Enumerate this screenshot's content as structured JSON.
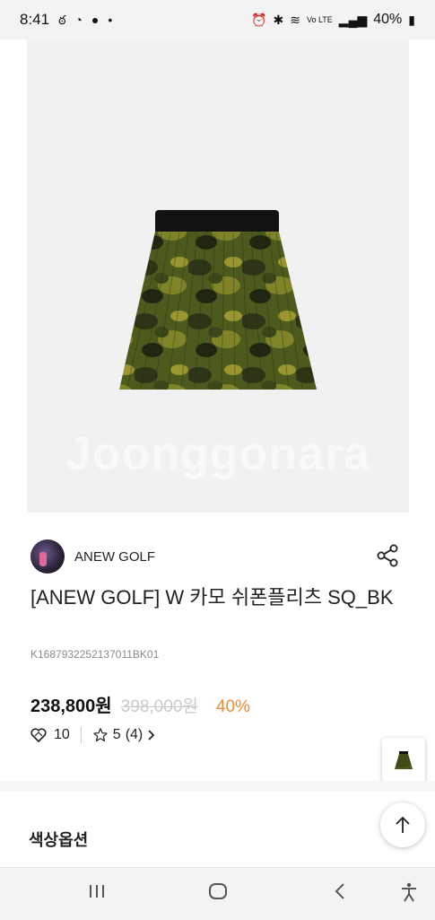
{
  "status": {
    "time": "8:41",
    "battery": "40%",
    "network": "Vo LTE"
  },
  "product": {
    "watermark": "Joonggonara",
    "brand": "ANEW GOLF",
    "title": "[ANEW GOLF] W 카모 쉬폰플리츠 SQ_BK",
    "code": "K1687932252137011BK01",
    "price": "238,800원",
    "original_price": "398,000원",
    "discount": "40%",
    "likes": "10",
    "rating": "5",
    "review_count": "(4)"
  },
  "sections": {
    "color_option_title": "색상옵션"
  },
  "icons": {
    "share": "share-icon",
    "heart": "heart-icon",
    "star": "star-icon",
    "scroll_top": "arrow-up-icon"
  },
  "colors": {
    "discount": "#ee8a33",
    "camo_dark": "#2e3516",
    "camo_mid": "#4d5a1e",
    "camo_light": "#8a8a2a"
  }
}
